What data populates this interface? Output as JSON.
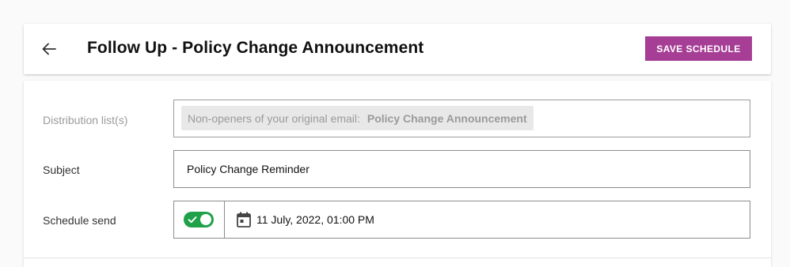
{
  "header": {
    "title": "Follow Up - Policy Change Announcement",
    "save_label": "SAVE SCHEDULE",
    "back_icon": "arrow-left-icon",
    "accent_color": "#a63e96"
  },
  "form": {
    "distribution": {
      "label": "Distribution list(s)",
      "chip_prefix": "Non-openers of your original email:",
      "chip_name": "Policy Change Announcement",
      "disabled": true
    },
    "subject": {
      "label": "Subject",
      "value": "Policy Change Reminder"
    },
    "schedule": {
      "label": "Schedule send",
      "toggle_on": true,
      "toggle_color": "#1fa14a",
      "calendar_icon": "calendar-icon",
      "date_text": "11 July, 2022, 01:00 PM"
    }
  }
}
